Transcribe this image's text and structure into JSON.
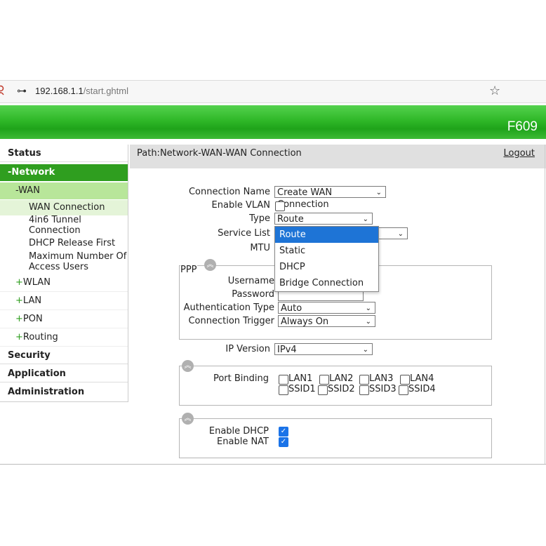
{
  "browser": {
    "url_host": "192.168.1.1",
    "url_path": "/start.ghtml",
    "key_icon": "key-icon",
    "star_icon": "star-icon"
  },
  "banner": {
    "model": "F609",
    "color": "#2fb828"
  },
  "menu": {
    "status": "Status",
    "network": "-Network",
    "wan": "-WAN",
    "wan_connection": "WAN Connection",
    "tunnel_1": "4in6 Tunnel",
    "tunnel_2": "Connection",
    "dhcp_release": "DHCP Release First",
    "max_users_1": "Maximum Number Of",
    "max_users_2": "Access Users",
    "wlan": "WLAN",
    "lan": "LAN",
    "pon": "PON",
    "routing": "Routing",
    "plus": "+",
    "security": "Security",
    "application": "Application",
    "administration": "Administration"
  },
  "header": {
    "path": "Path:Network-WAN-WAN Connection",
    "logout": "Logout"
  },
  "form": {
    "connection_name_label": "Connection Name",
    "connection_name_value": "Create WAN Connection",
    "enable_vlan_label": "Enable VLAN",
    "type_label": "Type",
    "type_value": "Route",
    "service_list_label": "Service List",
    "mtu_label": "MTU",
    "ppp_legend": "PPP",
    "username_label": "Username",
    "password_label": "Password",
    "auth_type_label": "Authentication Type",
    "auth_type_value": "Auto",
    "conn_trigger_label": "Connection Trigger",
    "conn_trigger_value": "Always On",
    "ip_version_label": "IP Version",
    "ip_version_value": "IPv4",
    "port_binding_label": "Port Binding",
    "ports": [
      "LAN1",
      "LAN2",
      "LAN3",
      "LAN4",
      "SSID1",
      "SSID2",
      "SSID3",
      "SSID4"
    ],
    "enable_dhcp_label": "Enable DHCP",
    "enable_nat_label": "Enable NAT",
    "enable_dhcp_checked": true,
    "enable_nat_checked": true
  },
  "type_dropdown": {
    "options": [
      "Route",
      "Static",
      "DHCP",
      "Bridge Connection"
    ],
    "highlighted": "Route",
    "highlight_color": "#1e74d6"
  }
}
